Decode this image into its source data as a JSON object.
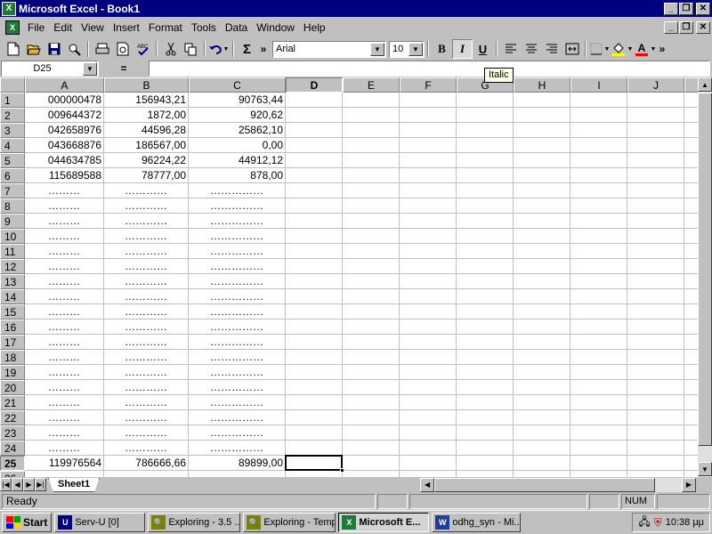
{
  "window": {
    "title": "Microsoft Excel - Book1",
    "app_icon_glyph": "X",
    "buttons": {
      "minimize": "_",
      "restore": "❐",
      "close": "✕"
    }
  },
  "menu": {
    "items": [
      {
        "label": "File",
        "name": "menu-file"
      },
      {
        "label": "Edit",
        "name": "menu-edit"
      },
      {
        "label": "View",
        "name": "menu-view"
      },
      {
        "label": "Insert",
        "name": "menu-insert"
      },
      {
        "label": "Format",
        "name": "menu-format"
      },
      {
        "label": "Tools",
        "name": "menu-tools"
      },
      {
        "label": "Data",
        "name": "menu-data"
      },
      {
        "label": "Window",
        "name": "menu-window"
      },
      {
        "label": "Help",
        "name": "menu-help"
      }
    ]
  },
  "toolbar": {
    "font": "Arial",
    "font_size": "10",
    "bold_glyph": "B",
    "italic_glyph": "I",
    "underline_glyph": "U",
    "autosum_glyph": "Σ",
    "more_glyph": "»",
    "tooltip": "Italic"
  },
  "formula_bar": {
    "name_box": "D25",
    "equals": "=",
    "formula": ""
  },
  "grid": {
    "columns": [
      "A",
      "B",
      "C",
      "D",
      "E",
      "F",
      "G",
      "H",
      "I",
      "J"
    ],
    "active_column": "D",
    "active_row": 25,
    "rows": [
      {
        "n": "1",
        "a": "000000478",
        "b": "156943,21",
        "c": "90763,44"
      },
      {
        "n": "2",
        "a": "009644372",
        "b": "1872,00",
        "c": "920,62"
      },
      {
        "n": "3",
        "a": "042658976",
        "b": "44596,28",
        "c": "25862,10"
      },
      {
        "n": "4",
        "a": "043668876",
        "b": "186567,00",
        "c": "0,00"
      },
      {
        "n": "5",
        "a": "044634785",
        "b": "96224,22",
        "c": "44912,12"
      },
      {
        "n": "6",
        "a": "115689588",
        "b": "78777,00",
        "c": "878,00"
      },
      {
        "n": "7",
        "a": "………",
        "b": "…………",
        "c": "……………"
      },
      {
        "n": "8",
        "a": "………",
        "b": "…………",
        "c": "……………"
      },
      {
        "n": "9",
        "a": "………",
        "b": "…………",
        "c": "……………"
      },
      {
        "n": "10",
        "a": "………",
        "b": "…………",
        "c": "……………"
      },
      {
        "n": "11",
        "a": "………",
        "b": "…………",
        "c": "……………"
      },
      {
        "n": "12",
        "a": "………",
        "b": "…………",
        "c": "……………"
      },
      {
        "n": "13",
        "a": "………",
        "b": "…………",
        "c": "……………"
      },
      {
        "n": "14",
        "a": "………",
        "b": "…………",
        "c": "……………"
      },
      {
        "n": "15",
        "a": "………",
        "b": "…………",
        "c": "……………"
      },
      {
        "n": "16",
        "a": "………",
        "b": "…………",
        "c": "……………"
      },
      {
        "n": "17",
        "a": "………",
        "b": "…………",
        "c": "……………"
      },
      {
        "n": "18",
        "a": "………",
        "b": "…………",
        "c": "……………"
      },
      {
        "n": "19",
        "a": "………",
        "b": "…………",
        "c": "……………"
      },
      {
        "n": "20",
        "a": "………",
        "b": "…………",
        "c": "……………"
      },
      {
        "n": "21",
        "a": "………",
        "b": "…………",
        "c": "……………"
      },
      {
        "n": "22",
        "a": "………",
        "b": "…………",
        "c": "……………"
      },
      {
        "n": "23",
        "a": "………",
        "b": "…………",
        "c": "……………"
      },
      {
        "n": "24",
        "a": "………",
        "b": "…………",
        "c": "……………"
      },
      {
        "n": "25",
        "a": "119976564",
        "b": "786666,66",
        "c": "89899,00"
      },
      {
        "n": "26",
        "a": "",
        "b": "",
        "c": ""
      }
    ]
  },
  "sheets": {
    "active": "Sheet1"
  },
  "status": {
    "text": "Ready",
    "num": "NUM"
  },
  "taskbar": {
    "start": "Start",
    "buttons": [
      {
        "label": "Serv-U [0]",
        "name": "task-servu",
        "active": false,
        "icon": "U",
        "color": "#000080"
      },
      {
        "label": "Exploring - 3.5 ...",
        "name": "task-exploring-1",
        "active": false,
        "icon": "🔍",
        "color": "#808000"
      },
      {
        "label": "Exploring - Temp",
        "name": "task-exploring-2",
        "active": false,
        "icon": "🔍",
        "color": "#808000"
      },
      {
        "label": "Microsoft E...",
        "name": "task-excel",
        "active": true,
        "icon": "X",
        "color": "#1f7a3a"
      },
      {
        "label": "odhg_syn - Mi...",
        "name": "task-word",
        "active": false,
        "icon": "W",
        "color": "#1c3f9c"
      }
    ],
    "clock": "10:38 μμ"
  }
}
